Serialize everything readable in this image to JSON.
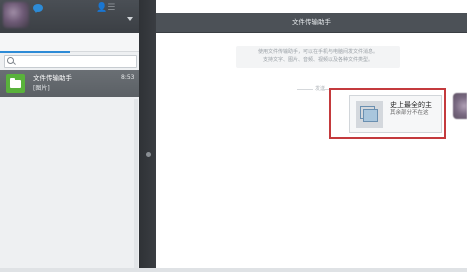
{
  "app": {
    "window_title": "文件传输助手"
  },
  "sidebar": {
    "conversation": {
      "title": "文件传输助手",
      "subtitle": "[图片]",
      "time": "8:53"
    },
    "tabs": [
      {
        "icon": "chat-icon"
      },
      {
        "label": "👤☰",
        "icon": "contacts-icon"
      }
    ],
    "search": {
      "placeholder": ""
    }
  },
  "chat": {
    "intro_lines": [
      "使用文件传输助手，可以在手机与电脑间发文件消息。",
      "支持文字、图片、音频、视频以及各种文件类型。"
    ],
    "separator_label": "发送",
    "file_card": {
      "name": "史上最全的主",
      "status": "其余部分不在这"
    }
  },
  "colors": {
    "accent": "#2d8bd6",
    "selection_bg": "#5e6368",
    "header_bg": "#4c5157",
    "highlight_border": "#c43a3d"
  }
}
